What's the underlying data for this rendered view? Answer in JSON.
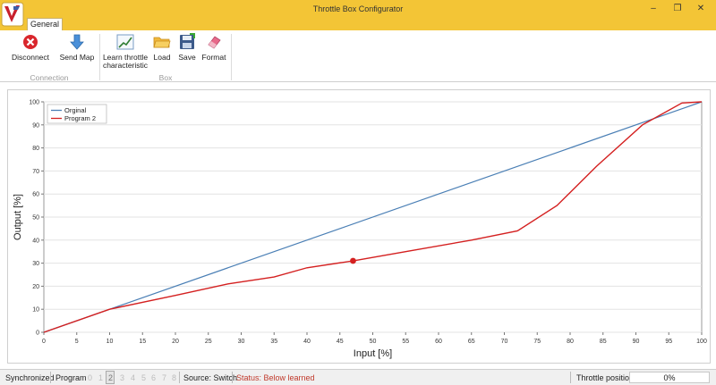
{
  "window": {
    "title": "Throttle Box Configurator"
  },
  "tabs": [
    {
      "label": "General"
    }
  ],
  "ribbon": {
    "disconnect_label": "Disconnect",
    "send_map_label": "Send Map",
    "learn_label_1": "Learn throttle",
    "learn_label_2": "characteristic",
    "load_label": "Load",
    "save_label": "Save",
    "format_label": "Format",
    "group_connection": "Connection",
    "group_box": "Box"
  },
  "colors": {
    "original": "#4a7fb5",
    "program": "#d42020",
    "accent": "#f3c536",
    "status_warn": "#c0392b"
  },
  "chart_data": {
    "type": "line",
    "xlabel": "Input [%]",
    "ylabel": "Output [%]",
    "xlim": [
      0,
      100
    ],
    "ylim": [
      0,
      100
    ],
    "xticks": [
      0,
      5,
      10,
      15,
      20,
      25,
      30,
      35,
      40,
      45,
      50,
      55,
      60,
      65,
      70,
      75,
      80,
      85,
      90,
      95,
      100
    ],
    "yticks": [
      0,
      10,
      20,
      30,
      40,
      50,
      60,
      70,
      80,
      90,
      100
    ],
    "grid": true,
    "legend": "top-left",
    "series": [
      {
        "name": "Orginal",
        "x": [
          0,
          10,
          100
        ],
        "y": [
          0,
          10,
          100
        ]
      },
      {
        "name": "Program 2",
        "x": [
          0,
          10,
          20,
          28,
          35,
          40,
          47,
          55,
          65,
          72,
          78,
          84,
          91,
          97,
          100
        ],
        "y": [
          0,
          10,
          16,
          21,
          24,
          28,
          31,
          35,
          40,
          44,
          55,
          72,
          90,
          99.5,
          100
        ]
      }
    ],
    "marker": {
      "x": 47,
      "y": 31
    }
  },
  "status": {
    "sync": "Synchronized",
    "program_label": "Program",
    "programs": [
      "0",
      "1",
      "2",
      "3",
      "4",
      "5",
      "6",
      "7",
      "8"
    ],
    "active_program": "2",
    "source": "Source: Switch",
    "status_text": "Status: Below learned",
    "throttle_label": "Throttle position",
    "throttle_value": "0%"
  }
}
